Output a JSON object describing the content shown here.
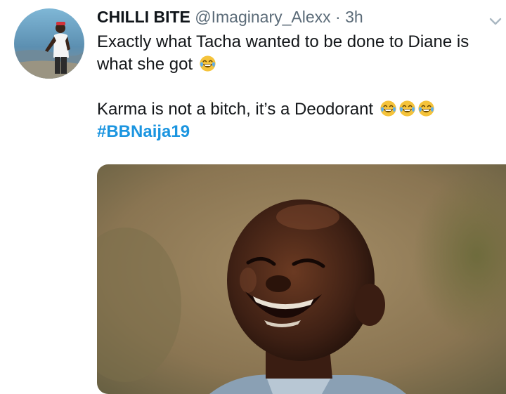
{
  "tweet": {
    "display_name": "CHILLI BITE",
    "handle": "@Imaginary_Alexx",
    "separator": "·",
    "time": "3h",
    "lines": [
      "Exactly what Tacha wanted to be done to Diane is",
      "what she got",
      "Karma is not a bitch, it’s a Deodorant"
    ],
    "hashtag": "#BBNaija19",
    "emoji_icon": "face-with-tears-of-joy-icon"
  },
  "colors": {
    "hashtag": "#1b95e0",
    "name": "#0f1419",
    "meta": "#5b6b78",
    "emoji": "#f5c33b"
  }
}
